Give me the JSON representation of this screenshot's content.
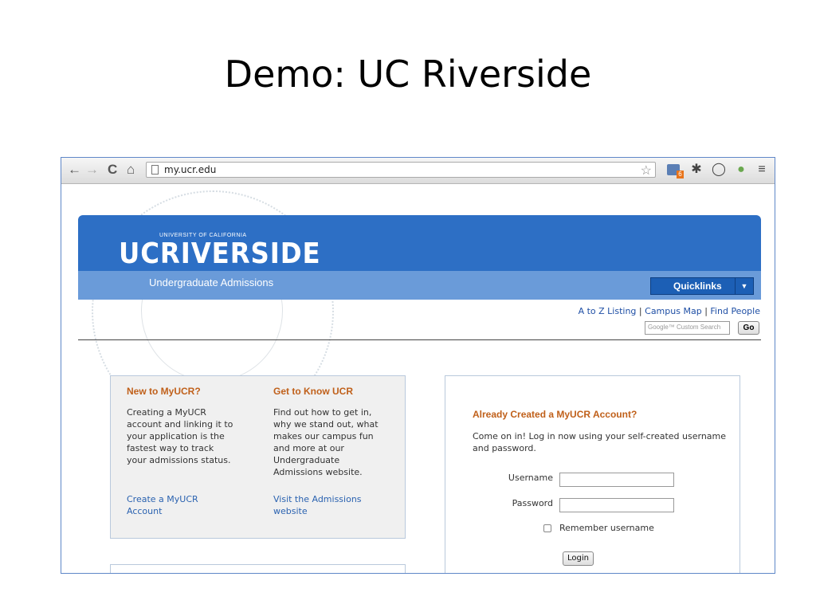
{
  "slide": {
    "title": "Demo: UC Riverside"
  },
  "browser": {
    "url": "my.ucr.edu",
    "badge_count": "6"
  },
  "site": {
    "logo": {
      "small": "UNIVERSITY OF CALIFORNIA",
      "main": "UCRIVERSIDE",
      "sub": "Undergraduate Admissions"
    },
    "quicklinks_label": "Quicklinks",
    "top_links": [
      "A to Z Listing",
      "Campus Map",
      "Find People"
    ],
    "search": {
      "placeholder": "Google™ Custom Search",
      "go_label": "Go"
    }
  },
  "new_to_myucr": {
    "heading": "New to MyUCR?",
    "text": "Creating a MyUCR\naccount and linking it to\nyour application is the\nfastest way to track\nyour admissions status.",
    "link": "Create a MyUCR\nAccount"
  },
  "get_to_know": {
    "heading": "Get to Know UCR",
    "text": "Find out how to get in,\nwhy we stand out, what\nmakes our campus fun\nand more at our\nUndergraduate\nAdmissions website.",
    "link": "Visit the Admissions\nwebsite"
  },
  "login": {
    "heading": "Already Created a MyUCR Account?",
    "text": "Come on in! Log in now using your self-created username and password.",
    "username_label": "Username",
    "password_label": "Password",
    "remember_label": "Remember username",
    "login_button": "Login"
  },
  "colors": {
    "banner": "#2d6fc5",
    "banner_light": "#6a9bd9",
    "heading_orange": "#c0601a",
    "link_blue": "#2a62b0"
  },
  "icons": [
    "back-icon",
    "forward-icon",
    "reload-icon",
    "home-icon",
    "page-icon",
    "star-icon",
    "calendar-extension-icon",
    "gear-icon",
    "circle-extension-icon",
    "brain-extension-icon",
    "menu-icon"
  ]
}
